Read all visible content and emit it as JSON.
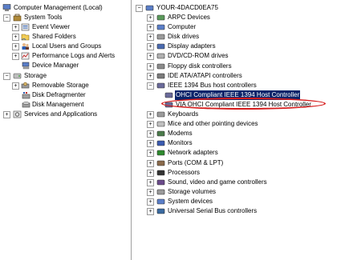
{
  "left_tree": {
    "root": "Computer Management (Local)",
    "system_tools": "System Tools",
    "event_viewer": "Event Viewer",
    "shared_folders": "Shared Folders",
    "local_users": "Local Users and Groups",
    "performance": "Performance Logs and Alerts",
    "device_manager": "Device Manager",
    "storage": "Storage",
    "removable_storage": "Removable Storage",
    "disk_defragmenter": "Disk Defragmenter",
    "disk_management": "Disk Management",
    "services_apps": "Services and Applications"
  },
  "right_tree": {
    "computer_name": "YOUR-4DACD0EA75",
    "categories": [
      "ARPC Devices",
      "Computer",
      "Disk drives",
      "Display adapters",
      "DVD/CD-ROM drives",
      "Floppy disk controllers",
      "IDE ATA/ATAPI controllers",
      "IEEE 1394 Bus host controllers"
    ],
    "ieee_children": [
      "OHCI Compliant IEEE 1394 Host Controller",
      "VIA OHCI Compliant IEEE 1394 Host Controller"
    ],
    "categories_after": [
      "Keyboards",
      "Mice and other pointing devices",
      "Modems",
      "Monitors",
      "Network adapters",
      "Ports (COM & LPT)",
      "Processors",
      "Sound, video and game controllers",
      "Storage volumes",
      "System devices",
      "Universal Serial Bus controllers"
    ]
  },
  "colors": {
    "selection": "#0a246a",
    "highlight_oval": "#d51c1c"
  }
}
